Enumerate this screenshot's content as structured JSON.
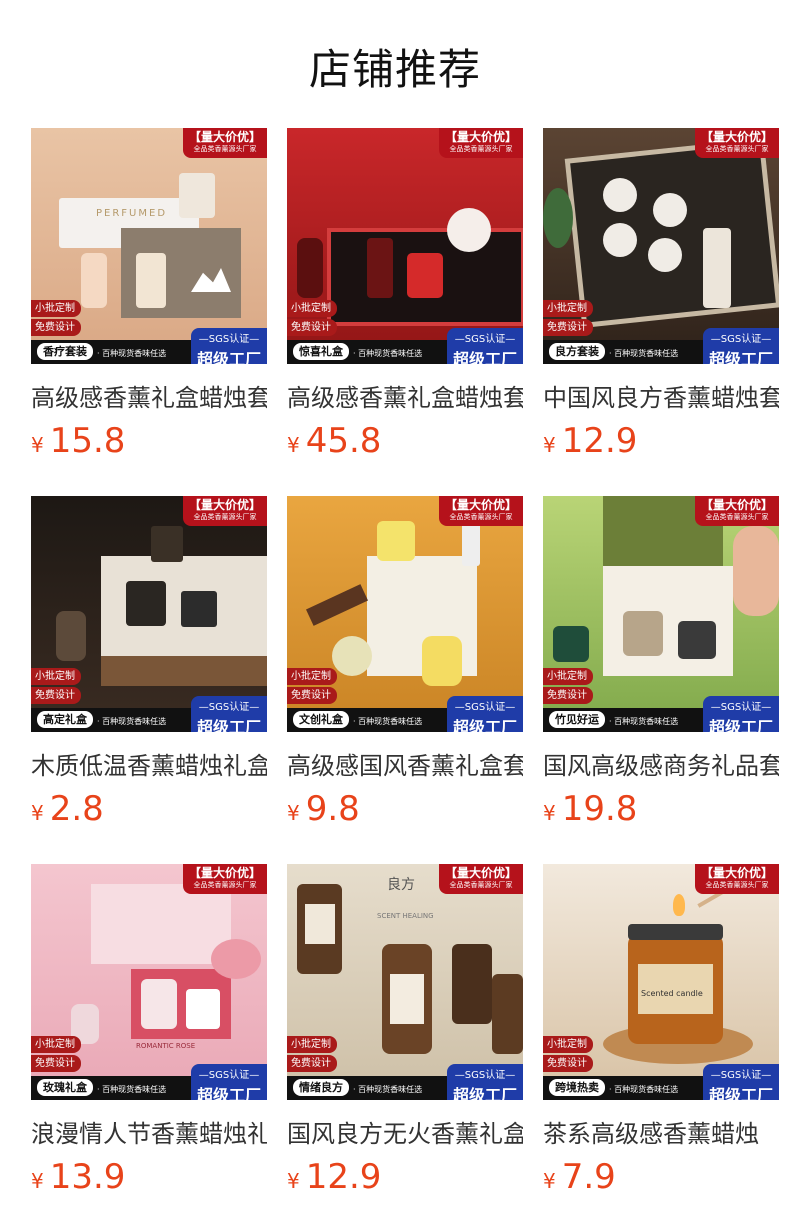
{
  "page_title": "店铺推荐",
  "badges": {
    "top_main": "【量大价优】",
    "top_sub": "全品类香薰源头厂家",
    "tag_small_batch": "小批定制",
    "tag_free_design": "免费设计",
    "slogan": "· 百种现货香味任选",
    "sgs_cert": "—SGS认证—",
    "super_factory": "超级工厂"
  },
  "currency": "¥",
  "products": [
    {
      "series": "香疗套装",
      "name": "高级感香薰礼盒蜡烛套装",
      "price": "15.8"
    },
    {
      "series": "惊喜礼盒",
      "name": "高级感香薰礼盒蜡烛套装",
      "price": "45.8"
    },
    {
      "series": "良方套装",
      "name": "中国风良方香薰蜡烛套装",
      "price": "12.9"
    },
    {
      "series": "高定礼盒",
      "name": "木质低温香薰蜡烛礼盒",
      "price": "2.8"
    },
    {
      "series": "文创礼盒",
      "name": "高级感国风香薰礼盒套装",
      "price": "9.8"
    },
    {
      "series": "竹见好运",
      "name": "国风高级感商务礼品套装",
      "price": "19.8"
    },
    {
      "series": "玫瑰礼盒",
      "name": "浪漫情人节香薰蜡烛礼盒",
      "price": "13.9"
    },
    {
      "series": "情绪良方",
      "name": "国风良方无火香薰礼盒",
      "price": "12.9"
    },
    {
      "series": "跨境热卖",
      "name": "茶系高级感香薰蜡烛",
      "price": "7.9"
    }
  ],
  "image_text": {
    "p1_box": "PERFUMED",
    "p9_jar": "Scented candle",
    "p8_label": "良方",
    "p8_scent": "SCENT HEALING",
    "p7_box": "ROMANTIC ROSE"
  },
  "colors": {
    "price": "#e8431a",
    "badge_red": "#b5121b",
    "sgs_blue": "#1f3ca8"
  }
}
